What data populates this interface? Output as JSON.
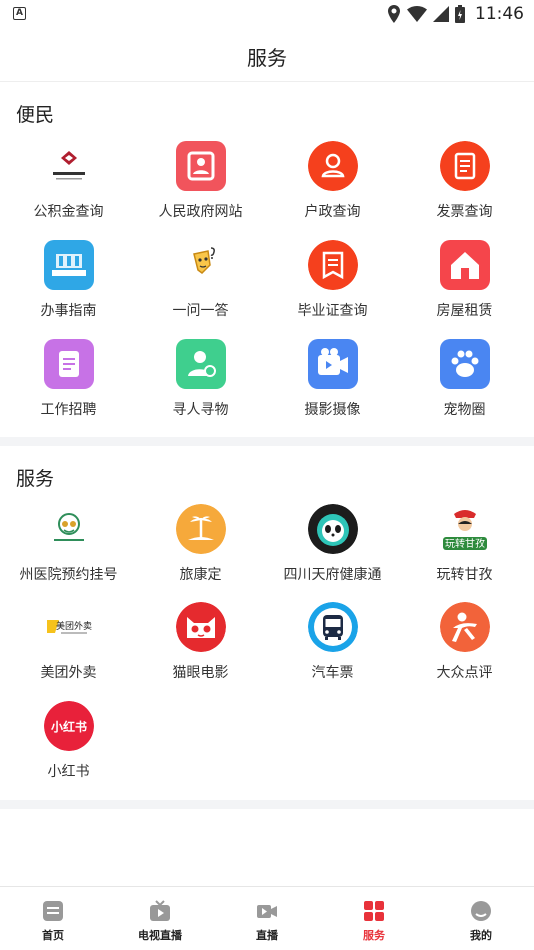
{
  "status_bar": {
    "notification_icon": "A",
    "time": "11:46"
  },
  "header": {
    "title": "服务"
  },
  "sections": [
    {
      "title": "便民",
      "items": [
        {
          "label": "公积金查询",
          "icon": "housing-fund-logo"
        },
        {
          "label": "人民政府网站",
          "icon": "government-site-icon"
        },
        {
          "label": "户政查询",
          "icon": "person-icon"
        },
        {
          "label": "发票查询",
          "icon": "invoice-icon"
        },
        {
          "label": "办事指南",
          "icon": "service-guide-icon"
        },
        {
          "label": "一问一答",
          "icon": "question-answer-icon"
        },
        {
          "label": "毕业证查询",
          "icon": "diploma-icon"
        },
        {
          "label": "房屋租赁",
          "icon": "house-icon"
        },
        {
          "label": "工作招聘",
          "icon": "job-icon"
        },
        {
          "label": "寻人寻物",
          "icon": "lost-found-icon"
        },
        {
          "label": "摄影摄像",
          "icon": "camera-icon"
        },
        {
          "label": "宠物圈",
          "icon": "pet-paw-icon"
        }
      ]
    },
    {
      "title": "服务",
      "items": [
        {
          "label": "州医院预约挂号",
          "icon": "hospital-logo"
        },
        {
          "label": "旅康定",
          "icon": "travel-icon"
        },
        {
          "label": "四川天府健康通",
          "icon": "health-panda-icon"
        },
        {
          "label": "玩转甘孜",
          "icon": "ganzi-logo",
          "logo_text": "玩转甘孜"
        },
        {
          "label": "美团外卖",
          "icon": "meituan-logo",
          "logo_text": "美团外卖"
        },
        {
          "label": "猫眼电影",
          "icon": "maoyan-cat-icon"
        },
        {
          "label": "汽车票",
          "icon": "bus-icon"
        },
        {
          "label": "大众点评",
          "icon": "dianping-icon"
        },
        {
          "label": "小红书",
          "icon": "xiaohongshu-icon",
          "logo_text": "小红书"
        }
      ]
    }
  ],
  "tabbar": {
    "items": [
      {
        "label": "首页",
        "icon": "home-doc-icon",
        "active": false
      },
      {
        "label": "电视直播",
        "icon": "tv-icon",
        "active": false
      },
      {
        "label": "直播",
        "icon": "video-camera-icon",
        "active": false
      },
      {
        "label": "服务",
        "icon": "grid-icon",
        "active": true
      },
      {
        "label": "我的",
        "icon": "profile-icon",
        "active": false
      }
    ]
  },
  "colors": {
    "accent": "#e8323a",
    "divider": "#f3f4f6"
  }
}
